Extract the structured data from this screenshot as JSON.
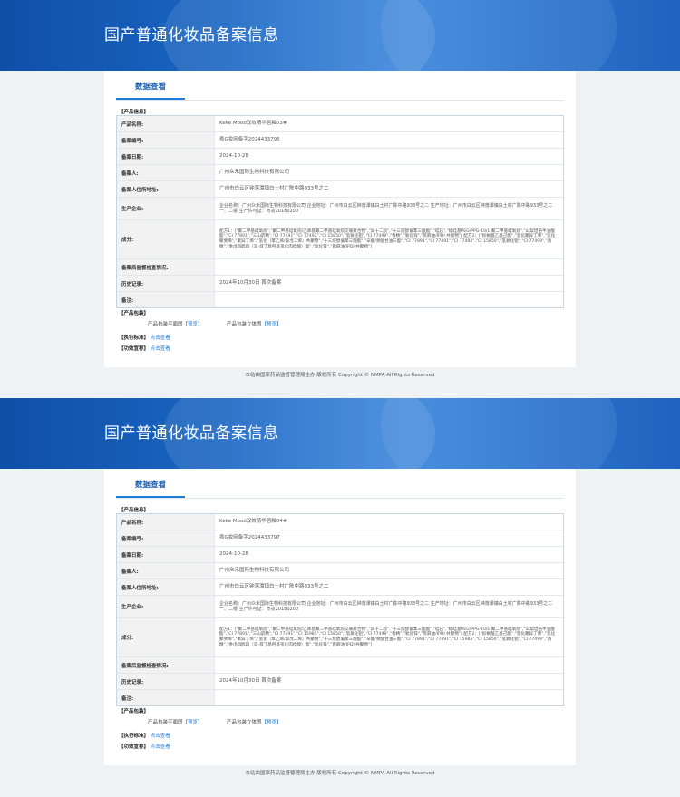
{
  "header": {
    "title": "国产普通化妆品备案信息"
  },
  "tab_label": "数据查看",
  "labels": {
    "product_info": "【产品信息】",
    "product_name": "产品名称:",
    "record_no": "备案编号:",
    "record_date": "备案日期:",
    "registrant": "备案人:",
    "registrant_addr": "备案人住所地址:",
    "producer": "生产企业:",
    "ingredients": "成分:",
    "post_check": "备案后监督检查情况:",
    "history": "历史记录:",
    "remark": "备注:",
    "packaging": "【产品包装】",
    "pkg_flat": "产品包装平面图",
    "pkg_3d": "产品包装立体图",
    "preview": "【预览】",
    "standard": "【执行标准】",
    "efficacy": "【功效宣称】",
    "view_link": "点击查看"
  },
  "footer": "本站由国家药品监督管理局主办 版权所有 Copyright © NMPA All Rights Reserved",
  "records": [
    {
      "product_name": "Keke Mood双效精华唇釉03#",
      "record_no": "粤G妆网备字2024433795",
      "record_date": "2024-10-28",
      "registrant": "广州众禾国际生物科技有限公司",
      "registrant_addr": "广州市白云区钟落潭镇白土村广陈中路933号之二",
      "producer": "企业名称：广州众禾国际生物科技有限公司 企业地址：广州市白云区钟落潭镇白土村广陈中路933号之二 生产地址：广州市白云区钟落潭镇白土村广陈中路933号之二一、二楼 生产许可证：粤妆20180200",
      "ingredients": "配方1：[\"聚二甲基硅氧烷\",\"聚二甲基硅氧烷/乙烯基聚二甲基硅氧烷交联聚合物\",\"异十二烷\",\"十三烷醇偏苯三酸酯\",\"硅石\",\"蜡硅基PEG/PPG-10/1 聚二甲基硅氧烷\",\"山梨坦倍半油酸酯\",\"CI 77891\",\"三山嵛精\",\"CI 77491\",\"CI 77492\",\"CI 15850\",\"氢氧化铝\",\"CI 77499\",\"香精\",\"氧化锌\",\"蔗麻油/IPDI 共聚物\"] 配方2：[\"棕榈酸乙基己酯\",\"氢化聚异丁烯\",\"氢化聚癸烯\",\"聚异丁烯\",\"氢化（苯乙烯/异戊二烯）共聚物\",\"十三烷醇偏苯三酸酯\",\"辛酸/癸酸甘油三酯\",\"CI 77891\",\"CI 77491\",\"CI 77492\",\"CI 15850\",\"氢氧化铝\",\"CI 77499\",\"香精\",\"季戊四醇四（双-叔丁基羟基氢化肉桂酸）酯\",\"氧化锌\",\"蓖麻油/IPDI 共聚物\"]",
      "post_check": "",
      "history": "2024年10月30日 首次备案",
      "remark": ""
    },
    {
      "product_name": "Keke Mood双效精华唇釉04#",
      "record_no": "粤G妆网备字2024433797",
      "record_date": "2024-10-28",
      "registrant": "广州众禾国际生物科技有限公司",
      "registrant_addr": "广州市白云区钟落潭镇白土村广陈中路933号之二",
      "producer": "企业名称：广州众禾国际生物科技有限公司 企业地址：广州市白云区钟落潭镇白土村广陈中路933号之二 生产地址：广州市白云区钟落潭镇白土村广陈中路933号之二一、二楼 生产许可证：粤妆20180200",
      "ingredients": "配方1：[\"聚二甲基硅氧烷\",\"聚二甲基硅氧烷/乙烯基聚二甲基硅氧烷交联聚合物\",\"异十二烷\",\"十三烷醇偏苯三酸酯\",\"硅石\",\"蜡硅基PEG/PPG-10/1 聚二甲基硅氧烷\",\"山梨坦倍半油酸酯\",\"CI 77891\",\"三山嵛精\",\"CI 77491\",\"CI 15985\",\"CI 15850\",\"氢氧化铝\",\"CI 77499\",\"香精\",\"氧化锌\",\"蔗麻油/IPDI 共聚物\"] 配方2：[\"棕榈酸乙基己酯\",\"氢化聚异丁烯\",\"氢化聚癸烯\",\"聚异丁烯\",\"氢化（苯乙烯/异戊二烯）共聚物\",\"十三烷醇偏苯三酸酯\",\"辛酸/癸酸甘油三酯\",\"CI 77891\",\"CI 77491\",\"CI 15985\",\"CI 15850\",\"氢氧化铝\",\"CI 77499\",\"香精\",\"季戊四醇四（双-叔丁基羟基氢化肉桂酸）酯\",\"氧化锌\",\"蓖麻油/IPDI 共聚物\"]",
      "post_check": "",
      "history": "2024年10月30日 首次备案",
      "remark": ""
    }
  ]
}
